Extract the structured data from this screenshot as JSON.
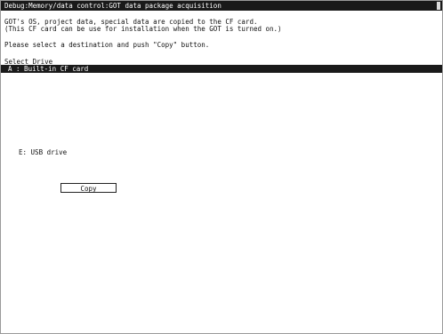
{
  "window": {
    "title": "Debug:Memory/data control:GOT data package acquisition"
  },
  "description": {
    "line1": "GOT's OS, project data, special data are copied to the CF card.",
    "line2": "(This CF card can be use for installation when the GOT is turned on.)",
    "line3": "Please select a destination and push \"Copy\" button."
  },
  "drive_select": {
    "label": "Select Drive",
    "options": [
      {
        "label": "A : Built-in CF card",
        "selected": true
      },
      {
        "label": "E: USB drive",
        "selected": false
      }
    ]
  },
  "actions": {
    "copy_label": "Copy"
  },
  "colors": {
    "titlebar_bg": "#1a1a1a",
    "selection_bg": "#1a1a1a",
    "background": "#ffffff"
  }
}
